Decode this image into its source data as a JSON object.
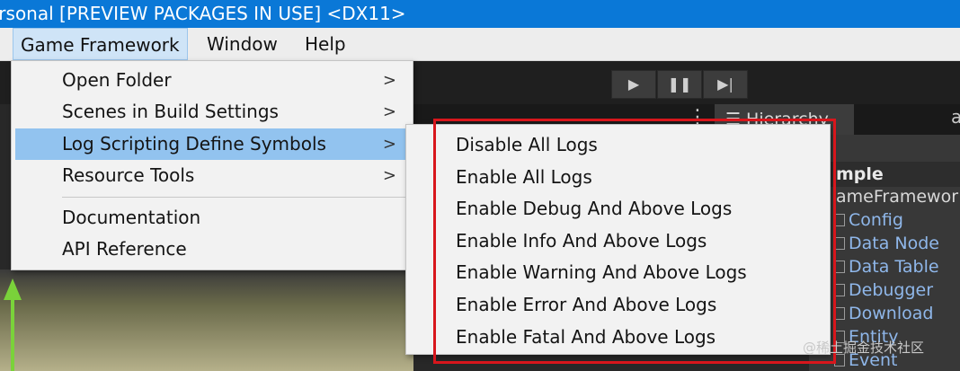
{
  "window": {
    "title": "ersonal [PREVIEW PACKAGES IN USE] <DX11>"
  },
  "menubar": {
    "items": [
      "Game Framework",
      "Window",
      "Help"
    ]
  },
  "toolbar": {
    "play_icon": "play-icon",
    "pause_icon": "pause-icon",
    "step_icon": "step-icon",
    "play_glyph": "▶",
    "pause_glyph": "❚❚",
    "step_glyph": "▶|"
  },
  "panels": {
    "hierarchy_tab": "Hierarchy",
    "more_glyph": "⋮"
  },
  "dropdown": {
    "items": [
      {
        "label": "Open Folder",
        "has_submenu": true
      },
      {
        "label": "Scenes in Build Settings",
        "has_submenu": true
      },
      {
        "label": "Log Scripting Define Symbols",
        "has_submenu": true,
        "highlighted": true
      },
      {
        "label": "Resource Tools",
        "has_submenu": true
      },
      {
        "label": "Documentation",
        "has_submenu": false
      },
      {
        "label": "API Reference",
        "has_submenu": false
      }
    ],
    "arrow_glyph": ">"
  },
  "submenu": {
    "items": [
      "Disable All Logs",
      "Enable All Logs",
      "Enable Debug And Above Logs",
      "Enable Info And Above Logs",
      "Enable Warning And Above Logs",
      "Enable Error And Above Logs",
      "Enable Fatal And Above Logs"
    ]
  },
  "hierarchy": {
    "scene": "mple",
    "root": "ameFramewor",
    "children": [
      "Config",
      "Data Node",
      "Data Table",
      "Debugger",
      "Download",
      "Entity",
      "Event"
    ]
  },
  "watermark": "@稀土掘金技术社区",
  "colors": {
    "title_bar": "#0a78d7",
    "menu_highlight": "#92c3ef",
    "annotation_box": "#d8161c",
    "hierarchy_link": "#8fb7ea"
  }
}
